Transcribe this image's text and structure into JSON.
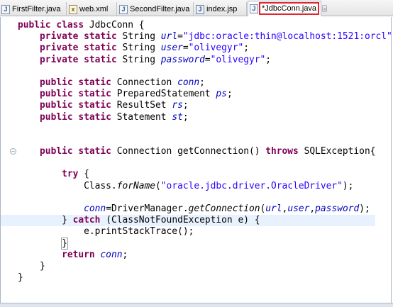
{
  "tabs": [
    {
      "label": "FirstFilter.java",
      "icon": "java-file-icon",
      "icon_glyph": "J"
    },
    {
      "label": "web.xml",
      "icon": "xml-file-icon",
      "icon_glyph": "x"
    },
    {
      "label": "SecondFilter.java",
      "icon": "java-file-icon",
      "icon_glyph": "J"
    },
    {
      "label": "index.jsp",
      "icon": "jsp-file-icon",
      "icon_glyph": "J"
    },
    {
      "label": "*JdbcConn.java",
      "icon": "java-file-icon",
      "icon_glyph": "J",
      "active": true,
      "close": "×"
    }
  ],
  "colors": {
    "keyword": "#7f0055",
    "field": "#0000c0",
    "string": "#2a00ff",
    "highlight_box": "#e0262f",
    "current_line": "#e8f2fe"
  },
  "fold_marker": "−",
  "code_lines": [
    [
      [
        "kw",
        "public class "
      ],
      [
        "",
        "JdbcConn {"
      ]
    ],
    [
      [
        "",
        "    "
      ],
      [
        "kw",
        "private static "
      ],
      [
        "",
        "String "
      ],
      [
        "fld",
        "url"
      ],
      [
        "",
        "="
      ],
      [
        "st",
        "\"jdbc:oracle:thin@localhost:1521:orcl\""
      ],
      [
        "",
        ";"
      ]
    ],
    [
      [
        "",
        "    "
      ],
      [
        "kw",
        "private static "
      ],
      [
        "",
        "String "
      ],
      [
        "fld",
        "user"
      ],
      [
        "",
        "="
      ],
      [
        "st",
        "\"olivegyr\""
      ],
      [
        "",
        ";"
      ]
    ],
    [
      [
        "",
        "    "
      ],
      [
        "kw",
        "private static "
      ],
      [
        "",
        "String "
      ],
      [
        "fld",
        "password"
      ],
      [
        "",
        "="
      ],
      [
        "st",
        "\"olivegyr\""
      ],
      [
        "",
        ";"
      ]
    ],
    [
      [
        "",
        ""
      ]
    ],
    [
      [
        "",
        "    "
      ],
      [
        "kw",
        "public static "
      ],
      [
        "",
        "Connection "
      ],
      [
        "fld",
        "conn"
      ],
      [
        "",
        ";"
      ]
    ],
    [
      [
        "",
        "    "
      ],
      [
        "kw",
        "public static "
      ],
      [
        "",
        "PreparedStatement "
      ],
      [
        "fld",
        "ps"
      ],
      [
        "",
        ";"
      ]
    ],
    [
      [
        "",
        "    "
      ],
      [
        "kw",
        "public static "
      ],
      [
        "",
        "ResultSet "
      ],
      [
        "fld",
        "rs"
      ],
      [
        "",
        ";"
      ]
    ],
    [
      [
        "",
        "    "
      ],
      [
        "kw",
        "public static "
      ],
      [
        "",
        "Statement "
      ],
      [
        "fld",
        "st"
      ],
      [
        "",
        ";"
      ]
    ],
    [
      [
        "",
        ""
      ]
    ],
    [
      [
        "",
        ""
      ]
    ],
    [
      [
        "",
        "    "
      ],
      [
        "kw",
        "public static "
      ],
      [
        "",
        "Connection getConnection() "
      ],
      [
        "kw",
        "throws "
      ],
      [
        "",
        "SQLException{"
      ]
    ],
    [
      [
        "",
        ""
      ]
    ],
    [
      [
        "",
        "        "
      ],
      [
        "kw",
        "try "
      ],
      [
        "",
        "{"
      ]
    ],
    [
      [
        "",
        "            Class."
      ],
      [
        "mi",
        "forName"
      ],
      [
        "",
        "("
      ],
      [
        "st",
        "\"oracle.jdbc.driver.OracleDriver\""
      ],
      [
        "",
        ");"
      ]
    ],
    [
      [
        "",
        ""
      ]
    ],
    [
      [
        "",
        "            "
      ],
      [
        "fld",
        "conn"
      ],
      [
        "",
        "=DriverManager."
      ],
      [
        "mi",
        "getConnection"
      ],
      [
        "",
        "("
      ],
      [
        "fld",
        "url"
      ],
      [
        "",
        ","
      ],
      [
        "fld",
        "user"
      ],
      [
        "",
        ","
      ],
      [
        "fld",
        "password"
      ],
      [
        "",
        ");"
      ]
    ],
    [
      [
        "",
        "        } "
      ],
      [
        "kw",
        "catch "
      ],
      [
        "",
        "(ClassNotFoundException e) {"
      ]
    ],
    [
      [
        "",
        "            e.printStackTrace();"
      ]
    ],
    [
      [
        "",
        "        "
      ],
      [
        "bracket",
        "}"
      ]
    ],
    [
      [
        "",
        "        "
      ],
      [
        "kw",
        "return "
      ],
      [
        "fld",
        "conn"
      ],
      [
        "",
        ";"
      ]
    ],
    [
      [
        "",
        "    }"
      ]
    ],
    [
      [
        "",
        "}"
      ]
    ]
  ],
  "current_line_index": 17,
  "fold_line_index": 11
}
